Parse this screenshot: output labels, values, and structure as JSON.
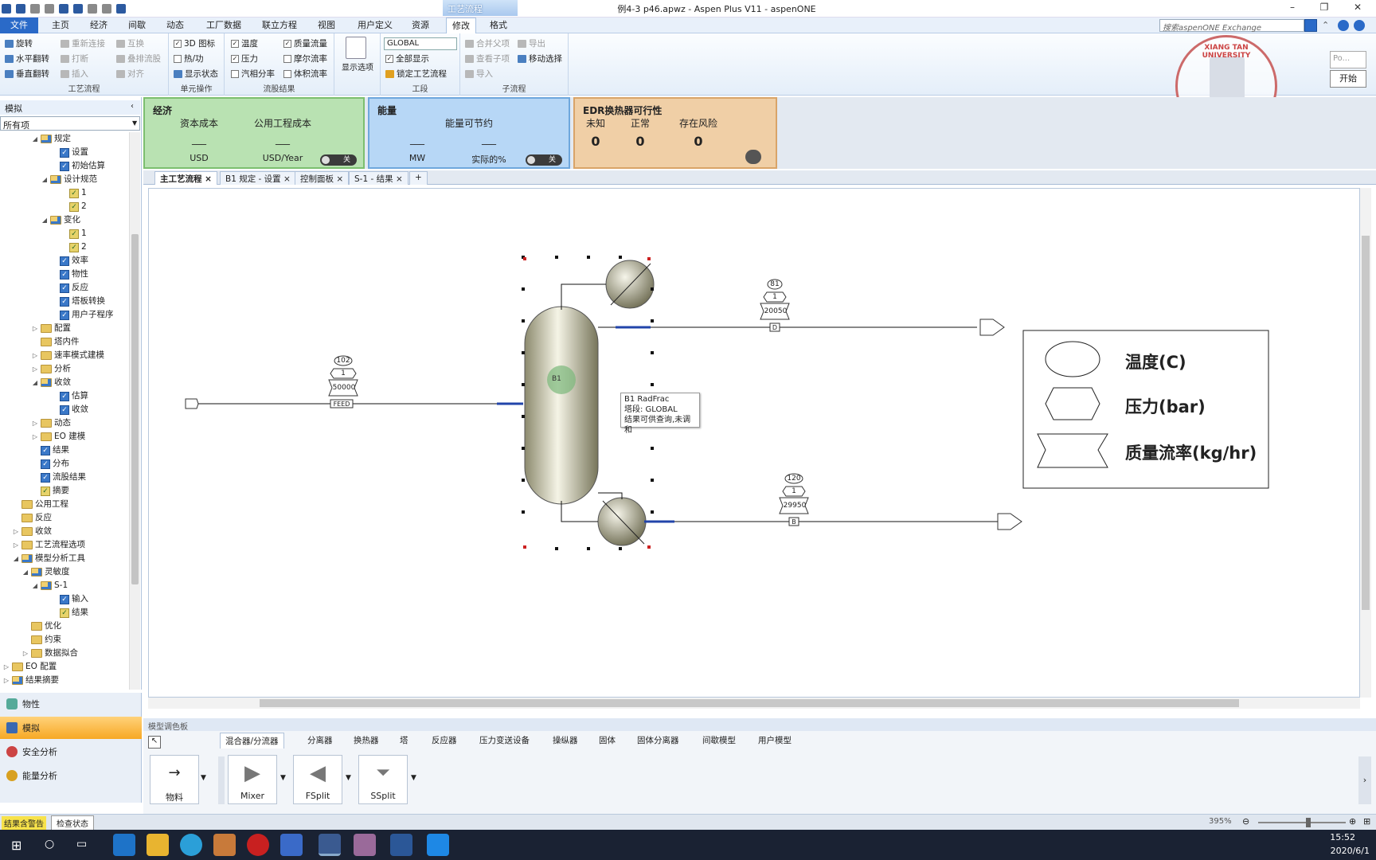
{
  "window": {
    "title": "例4-3 p46.apwz - Aspen Plus V11 - aspenONE",
    "context_tab": "工艺流程"
  },
  "menu": {
    "tabs": [
      "文件",
      "主页",
      "经济",
      "间歇",
      "动态",
      "工厂数据",
      "联立方程",
      "视图",
      "用户定义",
      "资源",
      "修改",
      "格式"
    ]
  },
  "search": {
    "placeholder": "搜索aspenONE Exchange"
  },
  "ribbon": {
    "flowsheet_group": {
      "label": "工艺流程",
      "rotate": "旋转",
      "hflip": "水平翻转",
      "vflip": "垂直翻转",
      "reconnect": "重新连接",
      "break": "打断",
      "insert": "插入",
      "exchange": "互换",
      "overlay": "叠排流股",
      "align": "对齐"
    },
    "unit_ops_group": {
      "label": "单元操作",
      "icon3d": "3D 图标",
      "heat_work": "热/功",
      "show_status": "显示状态"
    },
    "stream_results_group": {
      "label": "流股结果",
      "temperature": "温度",
      "pressure": "压力",
      "vapor_fraction": "汽相分率",
      "mass_flow": "质量流量",
      "mole_flow": "摩尔流率",
      "volume_flow": "体积流率"
    },
    "show_options": "显示选项",
    "section_group": {
      "label": "工段",
      "global": "GLOBAL",
      "show_all": "全部显示",
      "lock": "锁定工艺流程"
    },
    "subflowsheet_group": {
      "label": "子流程",
      "merge": "合并父项",
      "view_child": "查看子项",
      "import": "导入",
      "export": "导出",
      "move_select": "移动选择"
    }
  },
  "nav": {
    "header": "模拟",
    "filter": "所有项",
    "tree": [
      {
        "label": "规定",
        "indent": 3,
        "icon": "folder-blue",
        "tri": "◢"
      },
      {
        "label": "设置",
        "indent": 5,
        "icon": "check-blue",
        "tri": ""
      },
      {
        "label": "初始估算",
        "indent": 5,
        "icon": "check-blue",
        "tri": ""
      },
      {
        "label": "设计规范",
        "indent": 4,
        "icon": "folder-blue",
        "tri": "◢"
      },
      {
        "label": "1",
        "indent": 6,
        "icon": "check-yellow",
        "tri": ""
      },
      {
        "label": "2",
        "indent": 6,
        "icon": "check-yellow",
        "tri": ""
      },
      {
        "label": "变化",
        "indent": 4,
        "icon": "folder-blue",
        "tri": "◢"
      },
      {
        "label": "1",
        "indent": 6,
        "icon": "check-yellow",
        "tri": ""
      },
      {
        "label": "2",
        "indent": 6,
        "icon": "check-yellow",
        "tri": ""
      },
      {
        "label": "效率",
        "indent": 5,
        "icon": "check-blue",
        "tri": ""
      },
      {
        "label": "物性",
        "indent": 5,
        "icon": "check-blue",
        "tri": ""
      },
      {
        "label": "反应",
        "indent": 5,
        "icon": "check-blue",
        "tri": ""
      },
      {
        "label": "塔板转换",
        "indent": 5,
        "icon": "check-blue",
        "tri": ""
      },
      {
        "label": "用户子程序",
        "indent": 5,
        "icon": "check-blue",
        "tri": ""
      },
      {
        "label": "配置",
        "indent": 3,
        "icon": "folder",
        "tri": "▷"
      },
      {
        "label": "塔内件",
        "indent": 3,
        "icon": "folder",
        "tri": ""
      },
      {
        "label": "速率模式建模",
        "indent": 3,
        "icon": "folder",
        "tri": "▷"
      },
      {
        "label": "分析",
        "indent": 3,
        "icon": "folder",
        "tri": "▷"
      },
      {
        "label": "收敛",
        "indent": 3,
        "icon": "folder-blue",
        "tri": "◢"
      },
      {
        "label": "估算",
        "indent": 5,
        "icon": "check-blue",
        "tri": ""
      },
      {
        "label": "收敛",
        "indent": 5,
        "icon": "check-blue",
        "tri": ""
      },
      {
        "label": "动态",
        "indent": 3,
        "icon": "folder",
        "tri": "▷"
      },
      {
        "label": "EO 建模",
        "indent": 3,
        "icon": "folder",
        "tri": "▷"
      },
      {
        "label": "结果",
        "indent": 3,
        "icon": "check-blue",
        "tri": ""
      },
      {
        "label": "分布",
        "indent": 3,
        "icon": "check-blue",
        "tri": ""
      },
      {
        "label": "流股结果",
        "indent": 3,
        "icon": "check-blue",
        "tri": ""
      },
      {
        "label": "摘要",
        "indent": 3,
        "icon": "check-yellow",
        "tri": ""
      },
      {
        "label": "公用工程",
        "indent": 1,
        "icon": "folder",
        "tri": ""
      },
      {
        "label": "反应",
        "indent": 1,
        "icon": "folder",
        "tri": ""
      },
      {
        "label": "收敛",
        "indent": 1,
        "icon": "folder",
        "tri": "▷"
      },
      {
        "label": "工艺流程选项",
        "indent": 1,
        "icon": "folder",
        "tri": "▷"
      },
      {
        "label": "模型分析工具",
        "indent": 1,
        "icon": "folder-blue",
        "tri": "◢"
      },
      {
        "label": "灵敏度",
        "indent": 2,
        "icon": "folder-blue",
        "tri": "◢"
      },
      {
        "label": "S-1",
        "indent": 3,
        "icon": "folder-blue",
        "tri": "◢"
      },
      {
        "label": "输入",
        "indent": 5,
        "icon": "check-blue",
        "tri": ""
      },
      {
        "label": "结果",
        "indent": 5,
        "icon": "check-yellow",
        "tri": ""
      },
      {
        "label": "优化",
        "indent": 2,
        "icon": "folder",
        "tri": ""
      },
      {
        "label": "约束",
        "indent": 2,
        "icon": "folder",
        "tri": ""
      },
      {
        "label": "数据拟合",
        "indent": 2,
        "icon": "folder",
        "tri": "▷"
      },
      {
        "label": "EO 配置",
        "indent": 0,
        "icon": "folder",
        "tri": "▷"
      },
      {
        "label": "结果摘要",
        "indent": 0,
        "icon": "folder-blue",
        "tri": "▷"
      }
    ],
    "buttons": [
      "物性",
      "模拟",
      "安全分析",
      "能量分析"
    ]
  },
  "dashboard": {
    "economics": {
      "title": "经济",
      "capital_cost": "资本成本",
      "utility_cost": "公用工程成本",
      "capital_value": "___",
      "utility_value": "___",
      "capital_unit": "USD",
      "utility_unit": "USD/Year",
      "toggle": "关"
    },
    "energy": {
      "title": "能量",
      "savings": "能量可节约",
      "value1": "___",
      "value2": "___",
      "unit1": "MW",
      "unit2": "实际的%",
      "toggle": "关"
    },
    "edr": {
      "title": "EDR换热器可行性",
      "unknown": "未知",
      "ok": "正常",
      "risk": "存在风险",
      "unknown_count": "0",
      "ok_count": "0",
      "risk_count": "0"
    }
  },
  "doc_tabs": [
    "主工艺流程",
    "B1 规定 - 设置",
    "控制面板",
    "S-1 - 结果"
  ],
  "flowsheet": {
    "feed": {
      "label": "FEED",
      "temp": "102",
      "pressure": "1",
      "flow": "50000"
    },
    "distillate": {
      "label": "D",
      "temp": "81",
      "pressure": "1",
      "flow": "20050"
    },
    "bottoms": {
      "label": "B",
      "temp": "120",
      "pressure": "1",
      "flow": "29950"
    },
    "block_label": "B1",
    "tooltip": {
      "line1": "B1 RadFrac",
      "line2": "塔段: GLOBAL",
      "line3": "结果可供查询,未调和"
    },
    "legend": {
      "temp": "温度(C)",
      "pressure": "压力(bar)",
      "flow": "质量流率(kg/hr)"
    }
  },
  "palette": {
    "header": "模型调色板",
    "tabs": [
      "混合器/分流器",
      "分离器",
      "换热器",
      "塔",
      "反应器",
      "压力变送设备",
      "操纵器",
      "固体",
      "固体分离器",
      "间歇模型",
      "用户模型"
    ],
    "items": [
      "物料",
      "Mixer",
      "FSplit",
      "SSplit"
    ]
  },
  "status": {
    "left": "结果含警告",
    "check": "检查状态",
    "zoom": "395%"
  },
  "popup": {
    "placeholder": "Po...",
    "start": "开始"
  },
  "clock": {
    "time": "15:52",
    "date": "2020/6/1"
  },
  "stamp_text": "XIANG TAN UNIVERSITY",
  "colors": {
    "accent": "#2a6ac8",
    "econ_bg": "#b9e2b2",
    "energy_bg": "#b7d7f6",
    "edr_bg": "#f0cfa6",
    "nav_active": "#f7a824"
  }
}
